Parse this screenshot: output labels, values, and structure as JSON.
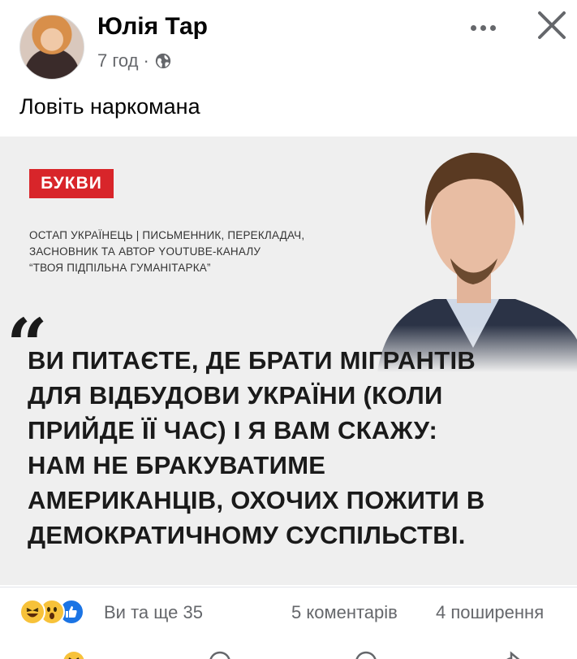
{
  "post": {
    "author": "Юлія Тар",
    "time": "7 год",
    "separator": "·",
    "text": "Ловіть наркомана"
  },
  "image": {
    "badge": "БУКВИ",
    "bio_lines": [
      "Остап Українець | письменник, перекладач,",
      "засновник та автор YouTube-каналу",
      "“Твоя підпільна Гуманітарка”"
    ],
    "quote_mark": "“",
    "quote_lines": [
      "Ви питаєте, де брати мігрантів",
      "для відбудови України (коли",
      "прийде її час) і я вам скажу:",
      "нам не бракуватиме",
      "американців, охочих пожити в",
      "демократичному суспільстві."
    ]
  },
  "footer": {
    "reactions_text": "Ви та ще 35",
    "comments": "5 коментарів",
    "shares": "4 поширення",
    "reaction_icons": [
      "haha-icon",
      "wow-icon",
      "like-icon"
    ]
  },
  "colors": {
    "badge": "#d8252a",
    "meta_text": "#65676b",
    "like_blue": "#1b74e4",
    "emoji_yellow": "#f7c23a"
  }
}
